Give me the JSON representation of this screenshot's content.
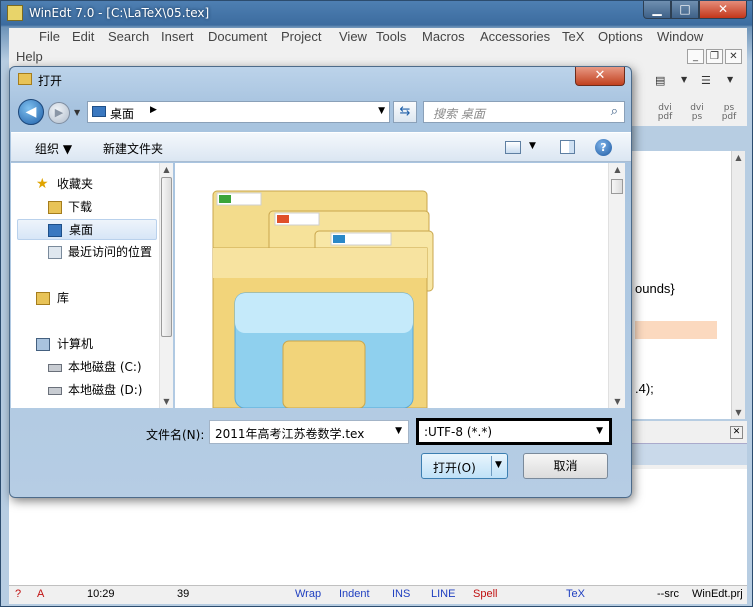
{
  "app": {
    "title": "WinEdt 7.0 - [C:\\LaTeX\\05.tex]",
    "window_controls": {
      "minimize": "▁",
      "maximize": "□",
      "close": "✕"
    }
  },
  "menu": [
    "File",
    "Edit",
    "Search",
    "Insert",
    "Document",
    "Project",
    "View",
    "Tools",
    "Macros",
    "Accessories",
    "TeX",
    "Options",
    "Window",
    "Help"
  ],
  "mdi_controls": {
    "minimize": "_",
    "restore": "❐",
    "close": "✕"
  },
  "toolbar": {
    "dvi_pdf": "dvi\npdf",
    "dvi_ps": "dvi\nps",
    "ps_pdf": "ps\npdf"
  },
  "editor": {
    "visible_line_1": "ounds}",
    "visible_line_2": ".4);"
  },
  "dialog": {
    "title": "打开",
    "close": "✕",
    "address": {
      "location": "桌面",
      "arrow": "▶"
    },
    "search_placeholder": "搜索 桌面",
    "commands": {
      "organize": "组织 ▼",
      "new_folder": "新建文件夹"
    },
    "nav": {
      "items": [
        {
          "label": "收藏夹",
          "icon": "star-icon"
        },
        {
          "label": "下载",
          "icon": "download-folder-icon"
        },
        {
          "label": "桌面",
          "icon": "desktop-icon",
          "selected": true
        },
        {
          "label": "最近访问的位置",
          "icon": "recent-places-icon"
        },
        {
          "label": "库",
          "icon": "library-icon"
        },
        {
          "label": "计算机",
          "icon": "computer-icon"
        },
        {
          "label": "本地磁盘 (C:)",
          "icon": "drive-c-icon"
        },
        {
          "label": "本地磁盘 (D:)",
          "icon": "drive-d-icon"
        }
      ]
    },
    "filename_label": "文件名(N):",
    "filename_value": "2011年高考江苏卷数学.tex",
    "filetype_value": ":UTF-8 (*.*)",
    "open_button": "打开(O)",
    "cancel_button": "取消"
  },
  "statusbar": {
    "help": "?",
    "mode": "A",
    "position": "10:29",
    "lines": "39",
    "wrap": "Wrap",
    "indent": "Indent",
    "ins": "INS",
    "line": "LINE",
    "spell": "Spell",
    "tex": "TeX",
    "src": "--src",
    "project": "WinEdt.prj"
  },
  "colors": {
    "titlebar": "#3c6c9f",
    "dialog_frame": "#b6cde4",
    "highlight_line": "#fbd9bf",
    "open_button": "#bfe1f7",
    "status_blue": "#1f3fc0",
    "status_red": "#c01010"
  }
}
